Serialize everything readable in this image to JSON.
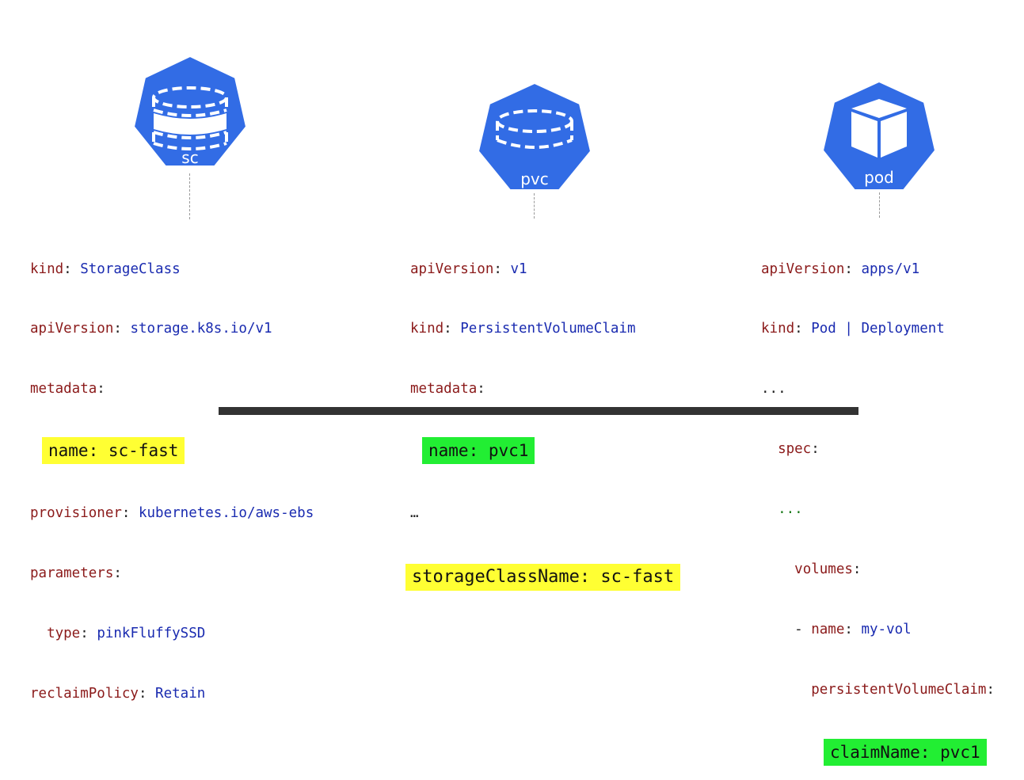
{
  "colors": {
    "hexagon": "#326ce5",
    "key": "#8b1a1a",
    "value": "#1a2bb0",
    "highlight_yellow": "#ffff33",
    "highlight_green": "#22ee33"
  },
  "icons": {
    "sc": {
      "label": "sc",
      "icon": "storage-class-icon"
    },
    "pvc": {
      "label": "pvc",
      "icon": "persistent-volume-claim-icon"
    },
    "pod": {
      "label": "pod",
      "icon": "pod-cube-icon"
    }
  },
  "sc_yaml": {
    "kind_key": "kind",
    "kind_val": "StorageClass",
    "api_key": "apiVersion",
    "api_val": "storage.k8s.io/v1",
    "meta_key": "metadata",
    "name_key": "name",
    "name_val": "sc-fast",
    "prov_key": "provisioner",
    "prov_val": "kubernetes.io/aws-ebs",
    "params_key": "parameters",
    "type_key": "type",
    "type_val": "pinkFluffySSD",
    "reclaim_key": "reclaimPolicy",
    "reclaim_val": "Retain"
  },
  "pvc_yaml": {
    "api_key": "apiVersion",
    "api_val": "v1",
    "kind_key": "kind",
    "kind_val": "PersistentVolumeClaim",
    "meta_key": "metadata",
    "name_key": "name",
    "name_val": "pvc1",
    "ellipsis": "…",
    "sc_key": "storageClassName",
    "sc_val": "sc-fast"
  },
  "pod_yaml": {
    "api_key": "apiVersion",
    "api_val": "apps/v1",
    "kind_key": "kind",
    "kind_val": "Pod | Deployment",
    "ellipsis1": "...",
    "spec_key": "spec",
    "ellipsis2": "...",
    "volumes_key": "volumes",
    "dash": "- ",
    "name_key": "name",
    "name_val": "my-vol",
    "pvc_key": "persistentVolumeClaim",
    "claim_key": "claimName",
    "claim_val": "pvc1"
  }
}
